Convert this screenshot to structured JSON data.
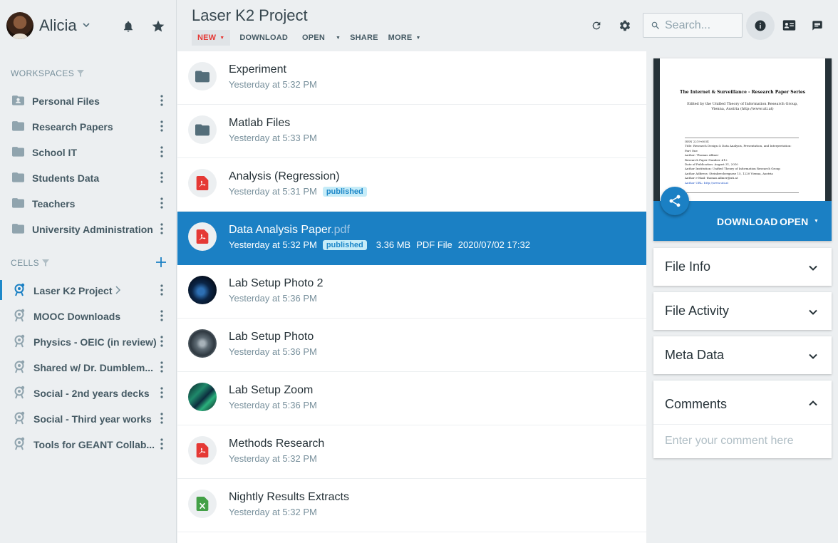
{
  "user": {
    "name": "Alicia"
  },
  "sidebar": {
    "workspaces_title": "WORKSPACES",
    "workspaces": [
      {
        "label": "Personal Files",
        "icon": "folder-account-icon"
      },
      {
        "label": "Research Papers",
        "icon": "folder-icon"
      },
      {
        "label": "School IT",
        "icon": "folder-icon"
      },
      {
        "label": "Students Data",
        "icon": "folder-icon"
      },
      {
        "label": "Teachers",
        "icon": "folder-icon"
      },
      {
        "label": "University Administration",
        "icon": "folder-icon"
      }
    ],
    "cells_title": "CELLS",
    "cells": [
      {
        "label": "Laser K2 Project",
        "active": true
      },
      {
        "label": "MOOC Downloads"
      },
      {
        "label": "Physics - OEIC (in review)"
      },
      {
        "label": "Shared w/ Dr. Dumblem..."
      },
      {
        "label": "Social - 2nd years decks"
      },
      {
        "label": "Social - Third year works"
      },
      {
        "label": "Tools for GEANT Collab..."
      }
    ]
  },
  "header": {
    "title": "Laser K2 Project",
    "toolbar": {
      "new": "NEW",
      "download": "DOWNLOAD",
      "open": "OPEN",
      "share": "SHARE",
      "more": "MORE"
    },
    "search_placeholder": "Search..."
  },
  "files": [
    {
      "name": "Experiment",
      "ext": "",
      "meta": "Yesterday at 5:32 PM",
      "type": "folder"
    },
    {
      "name": "Matlab Files",
      "ext": "",
      "meta": "Yesterday at 5:33 PM",
      "type": "folder"
    },
    {
      "name": "Analysis (Regression)",
      "ext": "",
      "meta": "Yesterday at 5:31 PM",
      "type": "pdf",
      "badge": "published"
    },
    {
      "name": "Data Analysis Paper",
      "ext": ".pdf",
      "meta": "Yesterday at 5:32 PM",
      "type": "pdf",
      "badge": "published",
      "size": "3.36 MB",
      "kind": "PDF File",
      "date": "2020/07/02 17:32",
      "selected": true
    },
    {
      "name": "Lab Setup Photo 2",
      "ext": "",
      "meta": "Yesterday at 5:36 PM",
      "type": "photo"
    },
    {
      "name": "Lab Setup Photo",
      "ext": "",
      "meta": "Yesterday at 5:36 PM",
      "type": "photo"
    },
    {
      "name": "Lab Setup Zoom",
      "ext": "",
      "meta": "Yesterday at 5:36 PM",
      "type": "photo"
    },
    {
      "name": "Methods Research",
      "ext": "",
      "meta": "Yesterday at 5:32 PM",
      "type": "pdf"
    },
    {
      "name": "Nightly Results Extracts",
      "ext": "",
      "meta": "Yesterday at 5:32 PM",
      "type": "spreadsheet"
    }
  ],
  "preview": {
    "doc_title": "The Internet & Surveillance - Research Paper Series",
    "doc_editor": "Edited by the Unified Theory of Information Research Group,",
    "doc_place": "Vienna, Austria (http://www.uti.at)",
    "doc_lines": [
      "ISSN 2219-603X",
      "Title: Research Design & Data Analysis, Presentation, and Interpretation:",
      "Part One",
      "Author: Thomas Allmer",
      "Research Paper Number #12",
      "Date of Publication: August 31, 2010",
      "Author Institution: Unified Theory of Information Research Group",
      "Author Address: Steinbrechergasse 15, 1220 Vienna, Austria",
      "Author e-Mail: thomas.allmer@uti.at",
      "Author URL: http://www.uti.at"
    ],
    "download": "DOWNLOAD",
    "open": "OPEN"
  },
  "panels": {
    "file_info": "File Info",
    "file_activity": "File Activity",
    "meta_data": "Meta Data",
    "comments": "Comments",
    "comment_placeholder": "Enter your comment here"
  },
  "colors": {
    "accent": "#1b80c4",
    "new_red": "#e53935",
    "badge_bg": "#c6ecf8",
    "pdf_red": "#e53935",
    "sheet_green": "#43a047"
  }
}
